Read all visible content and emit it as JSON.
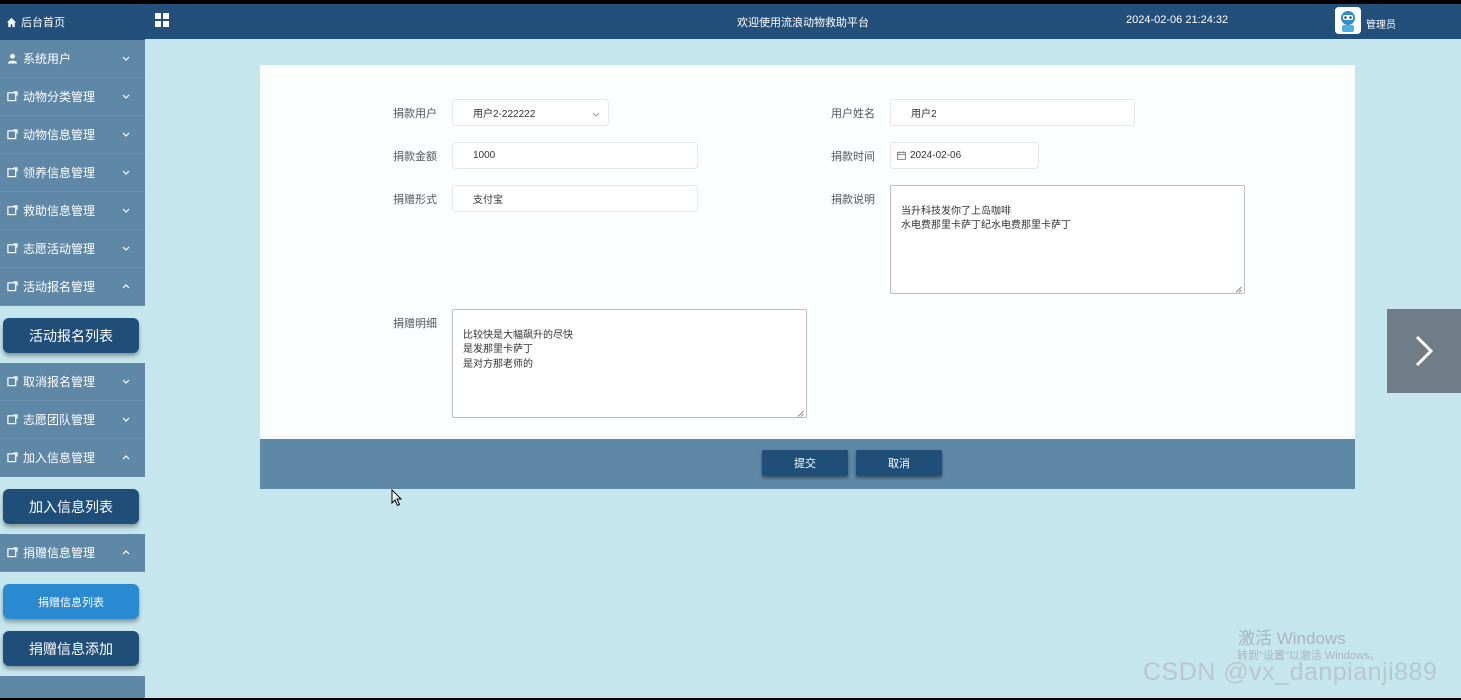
{
  "sidebar": {
    "home": "后台首页",
    "menus": [
      {
        "label": "系统用户",
        "icon": "user-icon",
        "expanded": false
      },
      {
        "label": "动物分类管理",
        "icon": "external-icon",
        "expanded": false
      },
      {
        "label": "动物信息管理",
        "icon": "external-icon",
        "expanded": false
      },
      {
        "label": "领养信息管理",
        "icon": "external-icon",
        "expanded": false
      },
      {
        "label": "救助信息管理",
        "icon": "external-icon",
        "expanded": false
      },
      {
        "label": "志愿活动管理",
        "icon": "external-icon",
        "expanded": false
      },
      {
        "label": "活动报名管理",
        "icon": "external-icon",
        "expanded": true,
        "sub": [
          "活动报名列表"
        ]
      },
      {
        "label": "取消报名管理",
        "icon": "external-icon",
        "expanded": false
      },
      {
        "label": "志愿团队管理",
        "icon": "external-icon",
        "expanded": false
      },
      {
        "label": "加入信息管理",
        "icon": "external-icon",
        "expanded": true,
        "sub": [
          "加入信息列表"
        ]
      },
      {
        "label": "捐赠信息管理",
        "icon": "external-icon",
        "expanded": true,
        "sub": [
          "捐赠信息列表",
          "捐赠信息添加"
        ],
        "active_sub": "捐赠信息列表"
      }
    ]
  },
  "topbar": {
    "title": "欢迎使用流浪动物救助平台",
    "datetime": "2024-02-06 21:24:32",
    "user": "管理员"
  },
  "form": {
    "donor_user": {
      "label": "捐款用户",
      "value": "用户2-222222"
    },
    "user_name": {
      "label": "用户姓名",
      "value": "用户2"
    },
    "amount": {
      "label": "捐款金额",
      "value": "1000"
    },
    "donate_time": {
      "label": "捐款时间",
      "value": "2024-02-06"
    },
    "donate_form": {
      "label": "捐赠形式",
      "value": "支付宝"
    },
    "donate_note": {
      "label": "捐款说明",
      "value": "当升科技发你了上岛咖啡\n水电费那里卡萨丁纪水电费那里卡萨丁"
    },
    "donate_detail": {
      "label": "捐赠明细",
      "value": "比较快是大幅飙升的尽快\n是发那里卡萨丁\n是对方那老师的"
    }
  },
  "buttons": {
    "submit": "提交",
    "cancel": "取消"
  },
  "watermark": {
    "activate_title": "激活 Windows",
    "activate_sub": "转到\"设置\"以激活 Windows。",
    "csdn": "CSDN @vx_danpianji889"
  }
}
